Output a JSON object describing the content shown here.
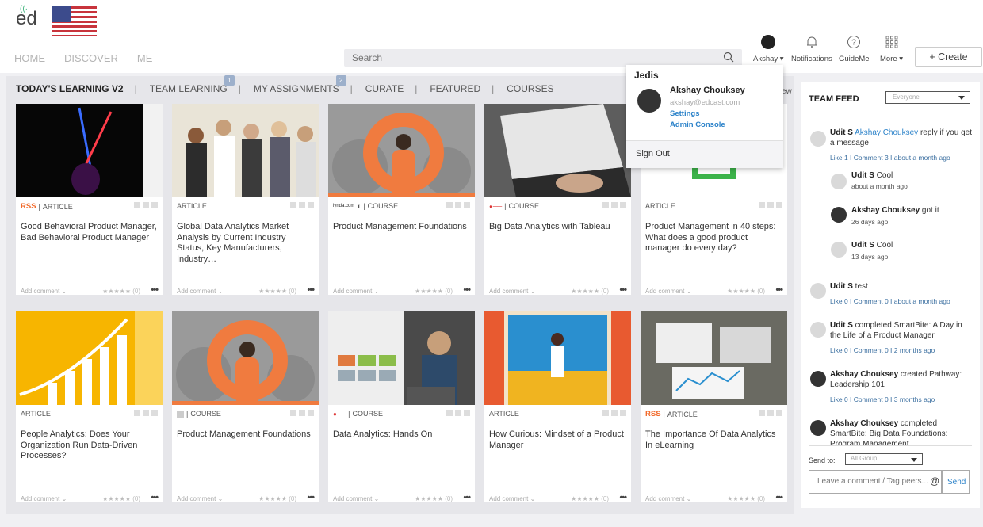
{
  "header": {
    "logo": "ed",
    "nav": [
      "HOME",
      "DISCOVER",
      "ME"
    ],
    "search_placeholder": "Search",
    "user_label": "Akshay",
    "notifications_label": "Notifications",
    "guideme_label": "GuideMe",
    "more_label": "More",
    "create_label": "+ Create"
  },
  "tabs": [
    {
      "label": "TODAY'S LEARNING V2"
    },
    {
      "label": "TEAM LEARNING",
      "badge": "1"
    },
    {
      "label": "MY ASSIGNMENTS",
      "badge": "2"
    },
    {
      "label": "CURATE"
    },
    {
      "label": "FEATURED"
    },
    {
      "label": "COURSES"
    }
  ],
  "view_label": "ew",
  "cards": [
    {
      "type": "ARTICLE",
      "source": "RSS",
      "title": "Good Behavioral Product Manager, Bad Behavioral Product Manager"
    },
    {
      "type": "ARTICLE",
      "source": "",
      "title": "Global Data Analytics Market Analysis by Current Industry Status, Key Manufacturers, Industry…"
    },
    {
      "type": "COURSE",
      "source": "lynda.com",
      "title": "Product Management Foundations"
    },
    {
      "type": "COURSE",
      "source": "",
      "title": "Big Data Analytics with Tableau"
    },
    {
      "type": "ARTICLE",
      "source": "",
      "title": "Product Management in 40 steps: What does a good product manager do every day?"
    },
    {
      "type": "ARTICLE",
      "source": "",
      "title": "People Analytics: Does Your Organization Run Data-Driven Processes?"
    },
    {
      "type": "COURSE",
      "source": "",
      "title": "Product Management Foundations"
    },
    {
      "type": "COURSE",
      "source": "",
      "title": "Data Analytics: Hands On"
    },
    {
      "type": "ARTICLE",
      "source": "",
      "title": "How Curious: Mindset of a Product Manager"
    },
    {
      "type": "ARTICLE",
      "source": "RSS",
      "title": "The Importance Of Data Analytics In eLearning"
    }
  ],
  "card_footer": {
    "add_comment": "Add comment ⌄",
    "rating": "★★★★★ (0)",
    "more": "•••"
  },
  "dropdown": {
    "org": "Jedis",
    "name": "Akshay Chouksey",
    "email": "akshay@edcast.com",
    "settings": "Settings",
    "admin": "Admin Console",
    "signout": "Sign Out"
  },
  "feed": {
    "title": "TEAM FEED",
    "filter": "Everyone",
    "items": [
      {
        "user": "Udit S",
        "text_link": "Akshay Chouksey",
        "text": " reply if you get a message",
        "meta": "Like 1   I   Comment 3   I   about a month ago"
      },
      {
        "user": "Udit S",
        "text": " Cool",
        "time": "about a month ago"
      },
      {
        "user": "Akshay Chouksey",
        "text": " got it",
        "time": "26 days ago"
      },
      {
        "user": "Udit S",
        "text": " Cool",
        "time": "13 days ago"
      },
      {
        "user": "Udit S",
        "text": " test",
        "meta": "Like 0   I   Comment 0   I   about a month ago"
      },
      {
        "user": "Udit S",
        "text": " completed SmartBite: A Day in the Life of a Product Manager",
        "meta": "Like 0   I   Comment 0   I   2 months ago"
      },
      {
        "user": "Akshay Chouksey",
        "text": " created Pathway: Leadership 101",
        "meta": "Like 0   I   Comment 0   I   3 months ago"
      },
      {
        "user": "Akshay Chouksey",
        "text": " completed SmartBite: Big Data Foundations: Program Management"
      }
    ],
    "send_to": "Send to:",
    "group": "All Group",
    "comment_placeholder": "Leave a comment / Tag peers...",
    "at": "@",
    "send": "Send"
  }
}
